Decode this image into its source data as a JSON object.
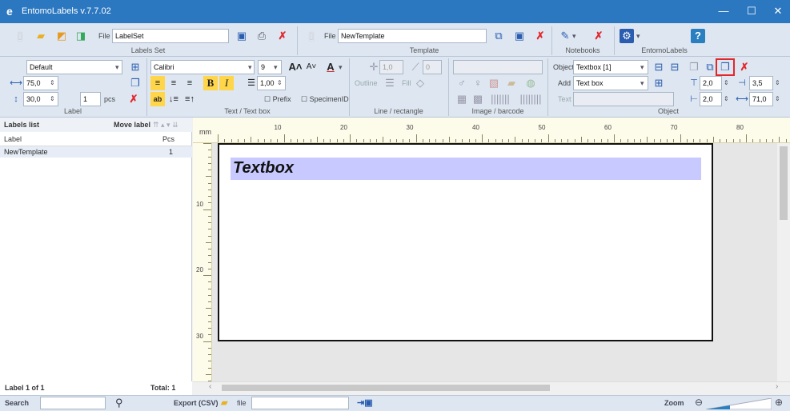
{
  "window": {
    "title": "EntomoLabels v.7.7.02",
    "logo_glyph": "e",
    "minimize": "—",
    "maximize": "☐",
    "close": "✕"
  },
  "labels_set": {
    "section_label": "Labels Set",
    "file_label": "File",
    "file_value": "LabelSet",
    "label_group": "Label",
    "template_combo": "Default",
    "width_value": "75,0",
    "height_value": "30,0",
    "count_value": "1",
    "count_unit": "pcs"
  },
  "text_box": {
    "section_label": "Text / Text box",
    "font": "Calibri",
    "size": "9",
    "line_spacing": "1,00",
    "prefix": "Prefix",
    "specimen_id": "SpecimenID",
    "bold": "B",
    "italic": "I",
    "grow": "A˄",
    "shrink": "A˅"
  },
  "template": {
    "section_label": "Template",
    "file_label": "File",
    "file_value": "NewTemplate",
    "line_section": "Line / rectangle",
    "image_section": "Image / barcode",
    "outline": "Outline",
    "fill": "Fill",
    "line_width": "1,0",
    "line_angle": "0"
  },
  "notebooks": {
    "section_label": "Notebooks"
  },
  "entomolabels": {
    "section_label": "EntomoLabels"
  },
  "object": {
    "section_label": "Object",
    "object_label": "Object",
    "object_value": "Textbox [1]",
    "add_label": "Add",
    "add_value": "Text box",
    "text_label": "Text",
    "margin_top": "2,0",
    "margin_right": "3,5",
    "margin_left": "2,0",
    "width": "71,0"
  },
  "labels_list": {
    "title": "Labels list",
    "move_label": "Move label",
    "col_label": "Label",
    "col_pcs": "Pcs",
    "rows": [
      {
        "label": "NewTemplate",
        "pcs": "1"
      }
    ],
    "status_label": "Label  1  of  1",
    "status_total": "Total:  1"
  },
  "canvas": {
    "unit": "mm",
    "h_ticks": [
      "10",
      "20",
      "30",
      "40",
      "50",
      "60",
      "70",
      "80"
    ],
    "v_ticks": [
      "10",
      "20",
      "30"
    ],
    "textbox_text": "Textbox",
    "textbox_fill": "#c8c9ff"
  },
  "bottom": {
    "search_label": "Search",
    "export_label": "Export (CSV)",
    "export_file_label": "file",
    "zoom_label": "Zoom"
  },
  "colors": {
    "titlebar": "#2b77c0",
    "ribbon": "#dde6f1",
    "delete_red": "#e3262b",
    "highlight": "#e3262b"
  }
}
